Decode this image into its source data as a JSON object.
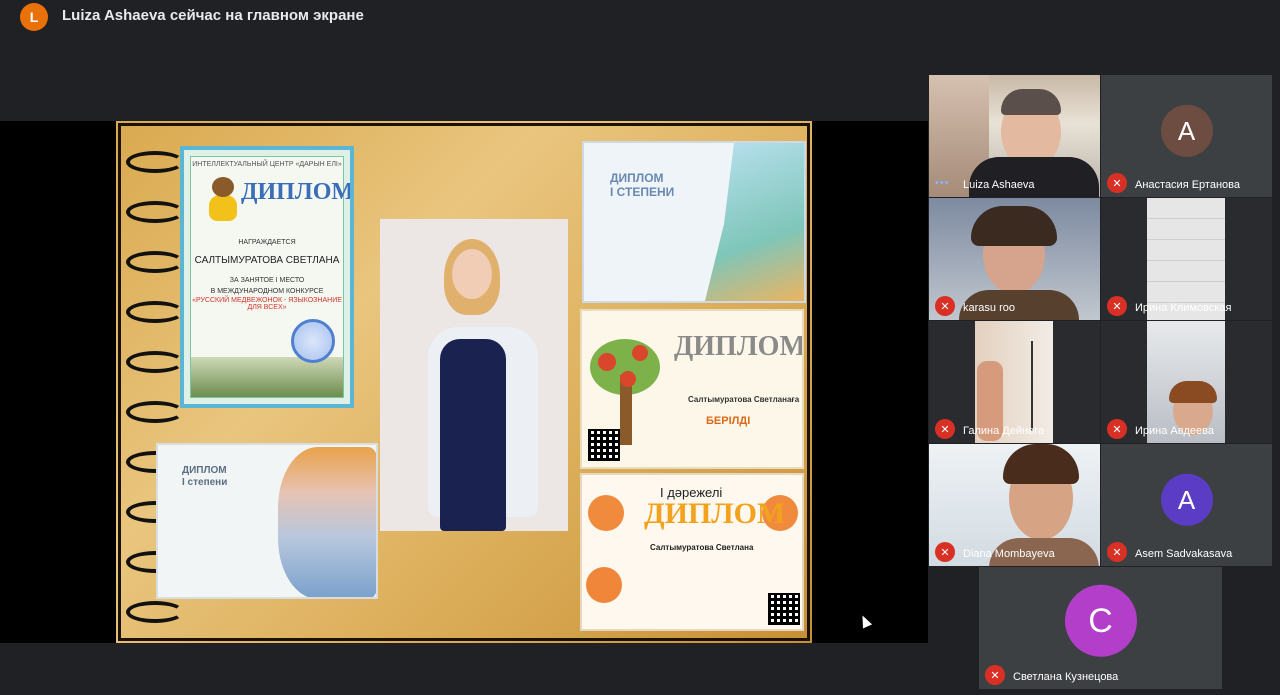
{
  "banner": {
    "avatar_letter": "L",
    "text": "Luiza Ashaeva сейчас на главном экране"
  },
  "slide": {
    "diploma1": {
      "header": "ИНТЕЛЛЕКТУАЛЬНЫЙ ЦЕНТР «ДАРЫН ЕЛІ»",
      "title": "ДИПЛОМ",
      "subtitle": "НАГРАЖДАЕТСЯ",
      "name": "САЛТЫМУРАТОВА СВЕТЛАНА",
      "place_line1": "ЗА ЗАНЯТОЕ I МЕСТО",
      "place_line2": "В МЕЖДУНАРОДНОМ КОНКУРСЕ",
      "red_line": "«РУССКИЙ МЕДВЕЖОНОК - ЯЗЫКОЗНАНИЕ ДЛЯ ВСЕХ»"
    },
    "diploma2": {
      "line1": "ДИПЛОМ",
      "line2": "I СТЕПЕНИ"
    },
    "diploma3": {
      "title": "ДИПЛОМ",
      "name": "Салтымуратова Светланаға",
      "given": "БЕРІЛДІ"
    },
    "diploma4": {
      "level": "I дәрежелі",
      "title": "ДИПЛОМ",
      "name": "Салтымуратова Светлана"
    },
    "diploma5": {
      "line1": "ДИПЛОМ",
      "line2": "I степени"
    }
  },
  "participants": [
    {
      "name": "Luiza Ashaeva",
      "video": true,
      "muted": false
    },
    {
      "name": "Анастасия Ертанова",
      "initial": "А",
      "color": "#6d4c41",
      "muted": true
    },
    {
      "name": "karasu roo",
      "video": true,
      "muted": true
    },
    {
      "name": "Ирина Климовская",
      "video": true,
      "muted": true
    },
    {
      "name": "Галина Дейнега",
      "video": true,
      "muted": true
    },
    {
      "name": "Ирина Авдеева",
      "video": true,
      "muted": true
    },
    {
      "name": "Diana Mombayeva",
      "video": true,
      "muted": true
    },
    {
      "name": "Asem Sadvakasava",
      "initial": "A",
      "color": "#5b3cc4",
      "muted": true
    },
    {
      "name": "Светлана Кузнецова",
      "initial": "С",
      "color": "#b23ec9",
      "muted": true
    }
  ],
  "icons": {
    "mic_off": "mic-off-icon",
    "speaking": "speaking-dots-icon",
    "pointer": "mouse-pointer-icon"
  }
}
